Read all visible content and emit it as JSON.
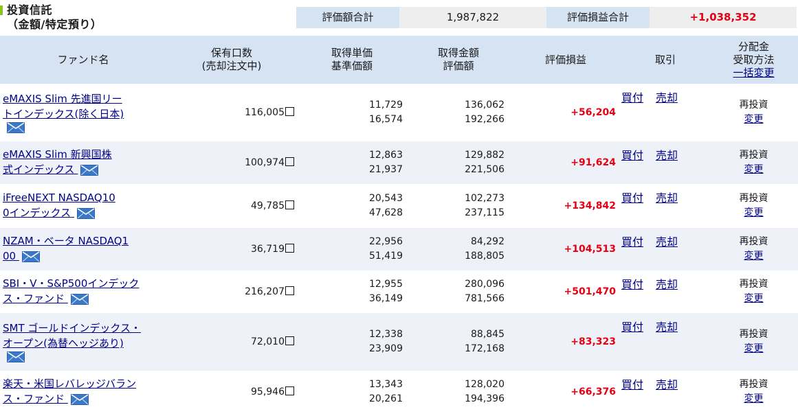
{
  "section": {
    "title_line1": "投資信託",
    "title_line2": "（金額/特定預り）"
  },
  "summary": {
    "valuation_label": "評価額合計",
    "valuation_value": "1,987,822",
    "gain_label": "評価損益合計",
    "gain_value": "+1,038,352"
  },
  "table": {
    "headers": {
      "fund_name": "ファンド名",
      "qty_line1": "保有口数",
      "qty_line2": "(売却注文中)",
      "unit_line1": "取得単価",
      "unit_line2": "基準価額",
      "amount_line1": "取得金額",
      "amount_line2": "評価額",
      "gain": "評価損益",
      "trade": "取引",
      "dist_line1": "分配金",
      "dist_line2": "受取方法",
      "dist_link": "一括変更"
    },
    "rows": [
      {
        "name_line1": "eMAXIS Slim 先進国リー",
        "name_line2": "トインデックス(除く日本)",
        "qty": "116,005",
        "cost_unit": "11,729",
        "nav": "16,574",
        "cost_amount": "136,062",
        "valuation": "192,266",
        "gain": "+56,204",
        "buy": "買付",
        "sell": "売却",
        "dist": "再投資",
        "dist_change": "変更"
      },
      {
        "name_line1": "eMAXIS Slim 新興国株",
        "name_line2": "式インデックス",
        "qty": "100,974",
        "cost_unit": "12,863",
        "nav": "21,937",
        "cost_amount": "129,882",
        "valuation": "221,506",
        "gain": "+91,624",
        "buy": "買付",
        "sell": "売却",
        "dist": "再投資",
        "dist_change": "変更"
      },
      {
        "name_line1": "iFreeNEXT NASDAQ10",
        "name_line2": "0インデックス",
        "qty": "49,785",
        "cost_unit": "20,543",
        "nav": "47,628",
        "cost_amount": "102,273",
        "valuation": "237,115",
        "gain": "+134,842",
        "buy": "買付",
        "sell": "売却",
        "dist": "再投資",
        "dist_change": "変更"
      },
      {
        "name_line1": "NZAM・ベータ NASDAQ1",
        "name_line2": "00",
        "qty": "36,719",
        "cost_unit": "22,956",
        "nav": "51,419",
        "cost_amount": "84,292",
        "valuation": "188,805",
        "gain": "+104,513",
        "buy": "買付",
        "sell": "売却",
        "dist": "再投資",
        "dist_change": "変更"
      },
      {
        "name_line1": "SBI・V・S&P500インデック",
        "name_line2": "ス・ファンド",
        "qty": "216,207",
        "cost_unit": "12,955",
        "nav": "36,149",
        "cost_amount": "280,096",
        "valuation": "781,566",
        "gain": "+501,470",
        "buy": "買付",
        "sell": "売却",
        "dist": "再投資",
        "dist_change": "変更"
      },
      {
        "name_line1": "SMT ゴールドインデックス・",
        "name_line2": "オープン(為替ヘッジあり)",
        "qty": "72,010",
        "cost_unit": "12,338",
        "nav": "23,909",
        "cost_amount": "88,845",
        "valuation": "172,168",
        "gain": "+83,323",
        "buy": "買付",
        "sell": "売却",
        "dist": "再投資",
        "dist_change": "変更"
      },
      {
        "name_line1": "楽天・米国レバレッジバラン",
        "name_line2": "ス・ファンド",
        "qty": "95,946",
        "cost_unit": "13,343",
        "nav": "20,261",
        "cost_amount": "128,020",
        "valuation": "194,396",
        "gain": "+66,376",
        "buy": "買付",
        "sell": "売却",
        "dist": "再投資",
        "dist_change": "変更"
      }
    ]
  },
  "icons": {
    "mail": "mail-icon",
    "order_box": "checkbox-icon"
  },
  "colors": {
    "header_bg": "#d5e3f2",
    "row_alt_bg": "#eef2f8",
    "gain_red": "#e60012",
    "link_navy": "#00008b",
    "marker_green": "#8dc21f"
  }
}
